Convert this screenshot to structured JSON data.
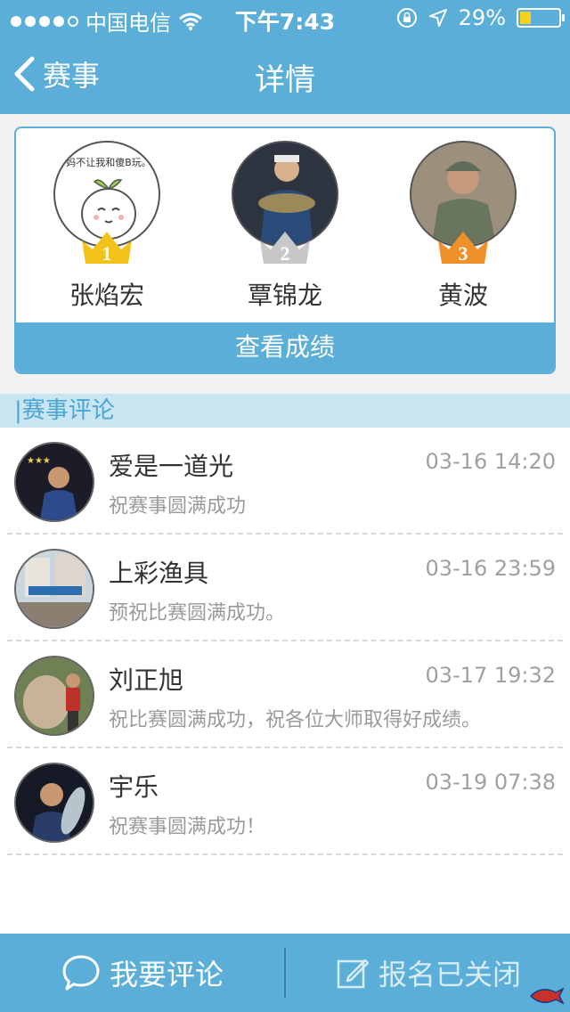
{
  "status_bar": {
    "carrier": "中国电信",
    "time": "下午7:43",
    "battery": "29%",
    "battery_level": 0.29,
    "icons": [
      "signal-dots-icon",
      "wifi-icon",
      "orientation-lock-icon",
      "location-icon",
      "battery-icon"
    ]
  },
  "nav": {
    "back_label": "赛事",
    "title": "详情"
  },
  "ranking": {
    "items": [
      {
        "rank": "1",
        "name": "张焰宏",
        "crown_color": "#f3c21b",
        "avatar_caption": "妈不让我和傻B玩。"
      },
      {
        "rank": "2",
        "name": "覃锦龙",
        "crown_color": "#c8c8c8"
      },
      {
        "rank": "3",
        "name": "黄波",
        "crown_color": "#f0902a"
      }
    ],
    "view_button": "查看成绩"
  },
  "comments_section": {
    "title": "|赛事评论",
    "items": [
      {
        "name": "爱是一道光",
        "time": "03-16 14:20",
        "text": "祝赛事圆满成功"
      },
      {
        "name": "上彩渔具",
        "time": "03-16 23:59",
        "text": "预祝比赛圆满成功。"
      },
      {
        "name": "刘正旭",
        "time": "03-17 19:32",
        "text": "祝比赛圆满成功，祝各位大师取得好成绩。"
      },
      {
        "name": "宇乐",
        "time": "03-19 07:38",
        "text": "祝赛事圆满成功！"
      }
    ]
  },
  "bottom_bar": {
    "comment_label": "我要评论",
    "signup_label": "报名已关闭"
  },
  "colors": {
    "primary": "#5aaed8",
    "section_bg": "#c9e5f2",
    "gold": "#f3c21b",
    "silver": "#c8c8c8",
    "bronze": "#f0902a"
  }
}
